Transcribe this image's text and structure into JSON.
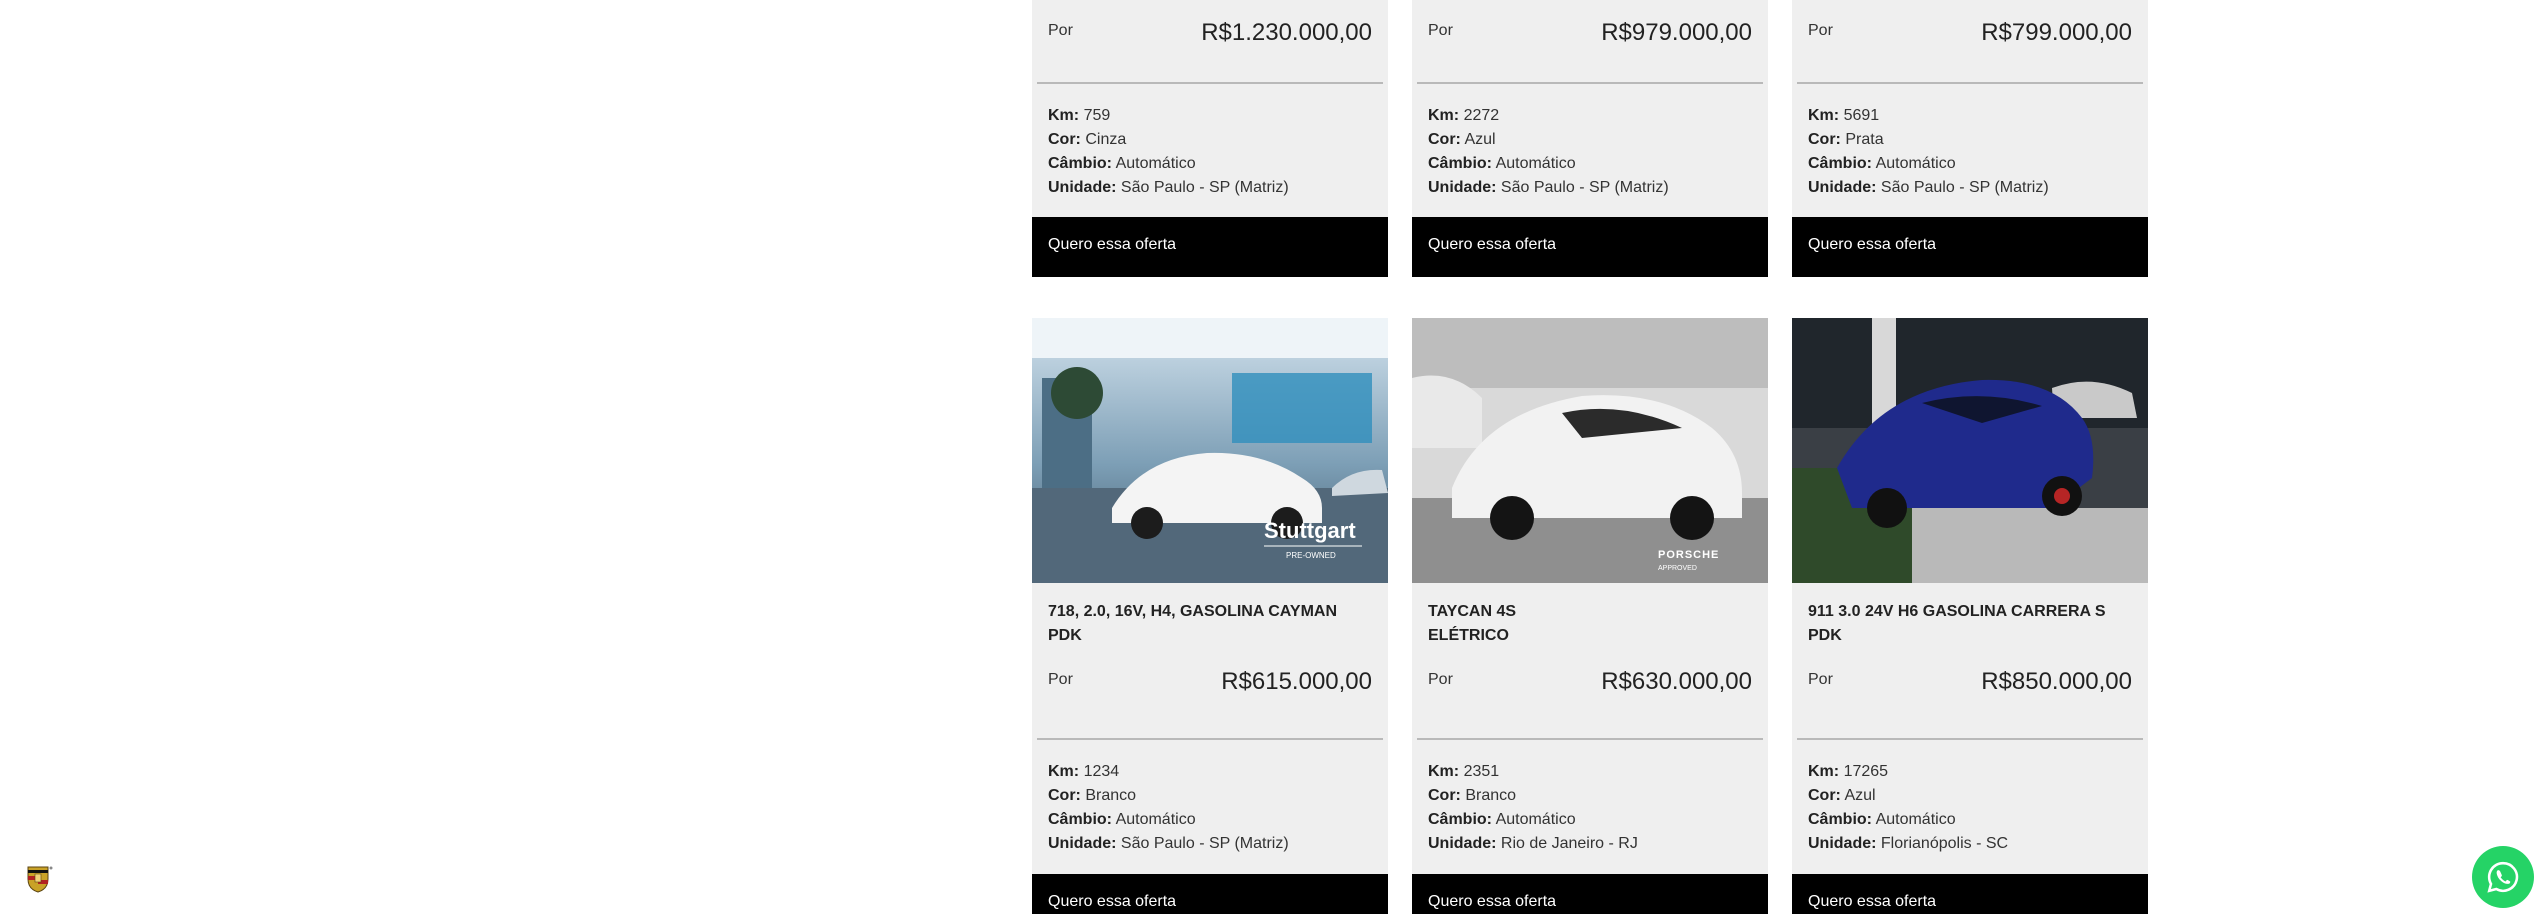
{
  "cta_label": "Quero essa oferta",
  "price_prefix": "Por",
  "spec_labels": {
    "km": "Km:",
    "color": "Cor:",
    "gearbox": "Câmbio:",
    "unit": "Unidade:"
  },
  "photo_brands": {
    "stuttgart": "Stuttgart",
    "stuttgart_sub": "PRE-OWNED",
    "porsche": "PORSCHE",
    "porsche_sub": "APPROVED"
  },
  "top_row": [
    {
      "price": "R$1.230.000,00",
      "km": "759",
      "color": "Cinza",
      "gearbox": "Automático",
      "unit": "São Paulo - SP (Matriz)"
    },
    {
      "price": "R$979.000,00",
      "km": "2272",
      "color": "Azul",
      "gearbox": "Automático",
      "unit": "São Paulo - SP (Matriz)"
    },
    {
      "price": "R$799.000,00",
      "km": "5691",
      "color": "Prata",
      "gearbox": "Automático",
      "unit": "São Paulo - SP (Matriz)"
    }
  ],
  "bottom_row": [
    {
      "title_line1": "718, 2.0, 16V, H4, GASOLINA CAYMAN",
      "title_line2": "PDK",
      "price": "R$615.000,00",
      "km": "1234",
      "color": "Branco",
      "gearbox": "Automático",
      "unit": "São Paulo - SP (Matriz)"
    },
    {
      "title_line1": "TAYCAN 4S",
      "title_line2": "ELÉTRICO",
      "price": "R$630.000,00",
      "km": "2351",
      "color": "Branco",
      "gearbox": "Automático",
      "unit": "Rio de Janeiro - RJ"
    },
    {
      "title_line1": "911 3.0 24V H6 GASOLINA CARRERA S",
      "title_line2": "PDK",
      "price": "R$850.000,00",
      "km": "17265",
      "color": "Azul",
      "gearbox": "Automático",
      "unit": "Florianópolis - SC"
    }
  ],
  "icons": {
    "crest": "porsche-crest-icon",
    "whatsapp": "whatsapp-icon"
  },
  "colors": {
    "card_bg": "#efefef",
    "cta_bg": "#000000",
    "whatsapp_green": "#25d366"
  }
}
